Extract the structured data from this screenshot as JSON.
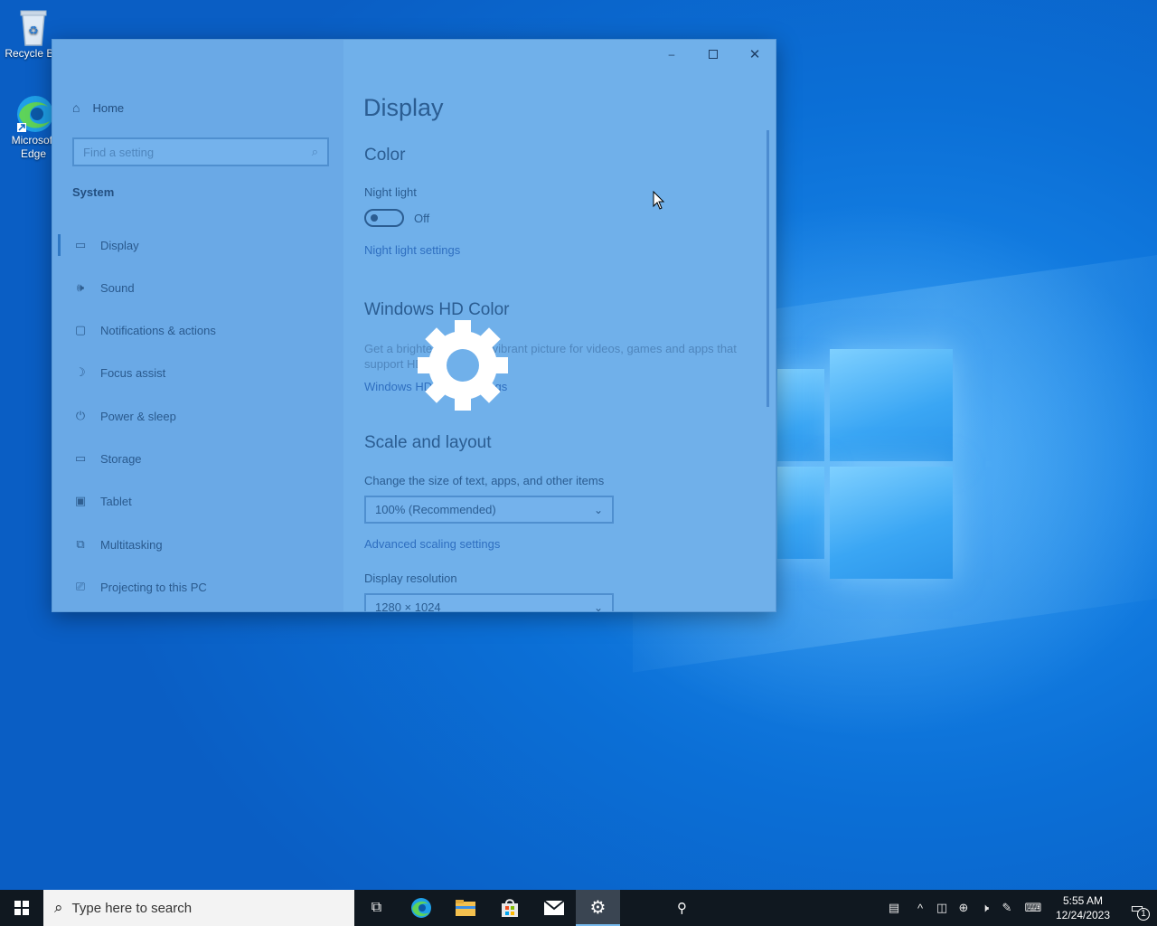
{
  "desktop": {
    "icons": [
      {
        "label": "Recycle Bin",
        "icon": "recycle-bin-icon"
      },
      {
        "label": "Microsoft Edge",
        "icon": "edge-icon"
      }
    ]
  },
  "window": {
    "controls": {
      "minimize": "—",
      "maximize": "☐",
      "close": "✕"
    },
    "sidebar": {
      "home": "Home",
      "search_placeholder": "Find a setting",
      "section": "System",
      "items": [
        {
          "label": "Display",
          "icon": "monitor-icon",
          "glyph": "▭"
        },
        {
          "label": "Sound",
          "icon": "speaker-icon",
          "glyph": "🕪"
        },
        {
          "label": "Notifications & actions",
          "icon": "notification-icon",
          "glyph": "▢"
        },
        {
          "label": "Focus assist",
          "icon": "moon-icon",
          "glyph": "☽"
        },
        {
          "label": "Power & sleep",
          "icon": "power-icon",
          "glyph": "⏻"
        },
        {
          "label": "Storage",
          "icon": "storage-icon",
          "glyph": "▭"
        },
        {
          "label": "Tablet",
          "icon": "tablet-icon",
          "glyph": "▣"
        },
        {
          "label": "Multitasking",
          "icon": "multitasking-icon",
          "glyph": "⧉"
        },
        {
          "label": "Projecting to this PC",
          "icon": "projector-icon",
          "glyph": "⎚"
        }
      ]
    },
    "main": {
      "title": "Display",
      "color_heading": "Color",
      "night_light_label": "Night light",
      "night_light_state": "Off",
      "night_light_link": "Night light settings",
      "hd_color_heading": "Windows HD Color",
      "hd_color_desc": "Get a brighter and more vibrant picture for videos, games and apps that support HDR.",
      "hd_color_link": "Windows HD Color settings",
      "scale_heading": "Scale and layout",
      "scale_label": "Change the size of text, apps, and other items",
      "scale_value": "100% (Recommended)",
      "scale_link": "Advanced scaling settings",
      "resolution_label": "Display resolution",
      "resolution_value": "1280 × 1024"
    }
  },
  "taskbar": {
    "search_placeholder": "Type here to search",
    "apps": [
      "task-view-icon",
      "edge-icon",
      "file-explorer-icon",
      "store-icon",
      "mail-icon",
      "settings-icon",
      "people-icon"
    ],
    "clock_time": "5:55 AM",
    "clock_date": "12/24/2023",
    "notification_count": "1"
  }
}
